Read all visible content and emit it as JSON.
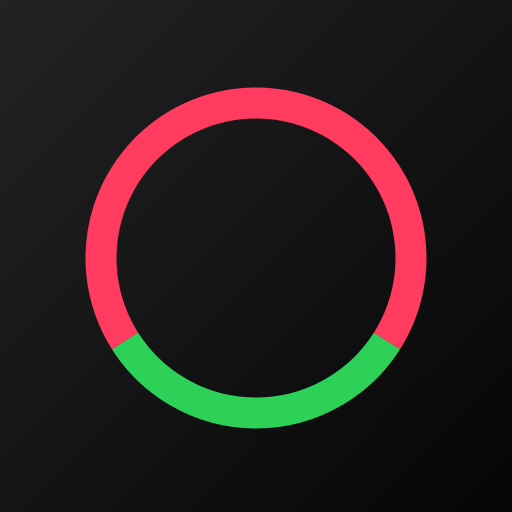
{
  "icon": {
    "name": "two-color-ring-icon",
    "background_gradient": [
      "#232325",
      "#050506"
    ],
    "ring": {
      "segments": [
        {
          "name": "red-arc",
          "color": "#FF3B5F",
          "share": 0.68
        },
        {
          "name": "green-arc",
          "color": "#2ED158",
          "share": 0.32
        }
      ]
    }
  }
}
